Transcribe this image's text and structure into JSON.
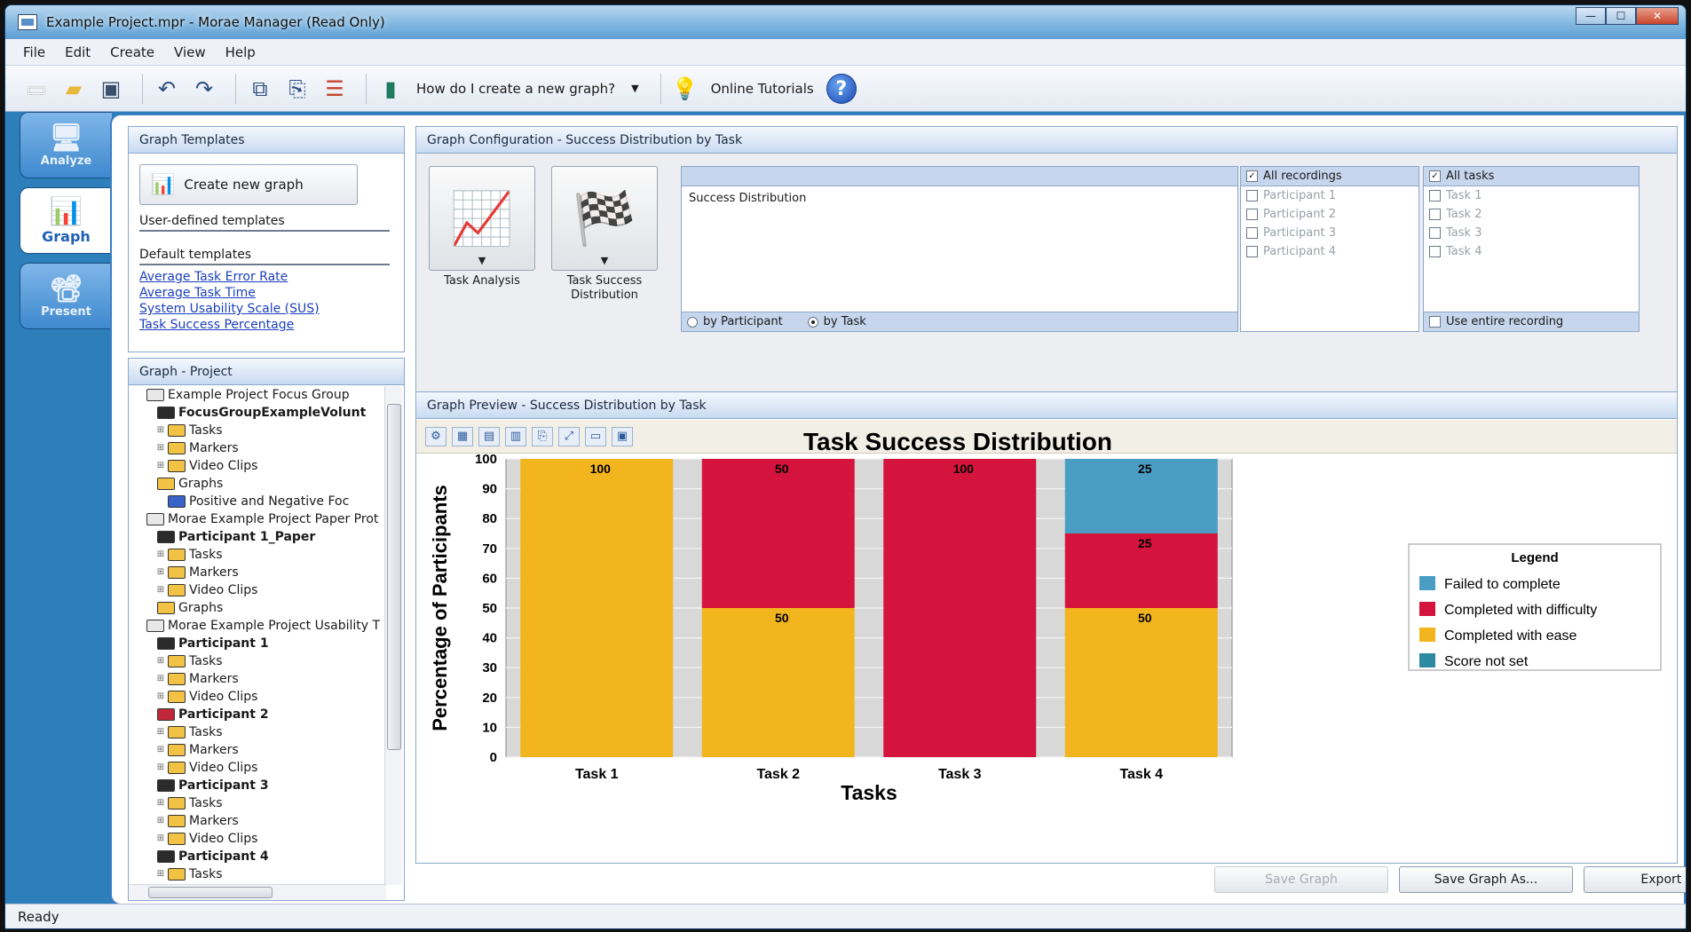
{
  "window": {
    "title": "Example Project.mpr - Morae Manager (Read Only)"
  },
  "menu": [
    "File",
    "Edit",
    "Create",
    "View",
    "Help"
  ],
  "toolbar": {
    "help_question": "How do I create a new graph?",
    "tutorials": "Online Tutorials",
    "help_glyph": "?"
  },
  "left_tabs": [
    {
      "label": "Analyze",
      "icon": "monitor-icon"
    },
    {
      "label": "Graph",
      "icon": "bar-chart-icon"
    },
    {
      "label": "Present",
      "icon": "projector-icon"
    }
  ],
  "templates": {
    "header": "Graph Templates",
    "create_button": "Create new graph",
    "user_defined": "User-defined templates",
    "default": "Default templates",
    "links": [
      "Average Task Error Rate",
      "Average Task Time",
      "System Usability Scale (SUS)",
      "Task Success Percentage"
    ]
  },
  "project": {
    "header": "Graph - Project",
    "tree": [
      {
        "level": 0,
        "text": "Example Project Focus Group",
        "icon": "project",
        "bold": false
      },
      {
        "level": 1,
        "text": "FocusGroupExampleVolunt",
        "icon": "recording",
        "bold": true
      },
      {
        "level": 2,
        "text": "Tasks",
        "icon": "folder-tasks",
        "bold": false
      },
      {
        "level": 2,
        "text": "Markers",
        "icon": "folder-markers",
        "bold": false
      },
      {
        "level": 2,
        "text": "Video Clips",
        "icon": "folder-clips",
        "bold": false
      },
      {
        "level": 1,
        "text": "Graphs",
        "icon": "folder-graphs",
        "bold": false
      },
      {
        "level": 2,
        "text": "Positive and Negative Foc",
        "icon": "graph",
        "bold": false
      },
      {
        "level": 0,
        "text": "Morae Example Project Paper Prot",
        "icon": "project",
        "bold": false
      },
      {
        "level": 1,
        "text": "Participant 1_Paper",
        "icon": "recording",
        "bold": true
      },
      {
        "level": 2,
        "text": "Tasks",
        "icon": "folder-tasks",
        "bold": false
      },
      {
        "level": 2,
        "text": "Markers",
        "icon": "folder-markers",
        "bold": false
      },
      {
        "level": 2,
        "text": "Video Clips",
        "icon": "folder-clips",
        "bold": false
      },
      {
        "level": 1,
        "text": "Graphs",
        "icon": "folder-graphs",
        "bold": false
      },
      {
        "level": 0,
        "text": "Morae Example Project Usability T",
        "icon": "project",
        "bold": false
      },
      {
        "level": 1,
        "text": "Participant 1",
        "icon": "recording",
        "bold": true
      },
      {
        "level": 2,
        "text": "Tasks",
        "icon": "folder-tasks",
        "bold": false
      },
      {
        "level": 2,
        "text": "Markers",
        "icon": "folder-markers",
        "bold": false
      },
      {
        "level": 2,
        "text": "Video Clips",
        "icon": "folder-clips",
        "bold": false
      },
      {
        "level": 1,
        "text": "Participant 2",
        "icon": "recording-red",
        "bold": true
      },
      {
        "level": 2,
        "text": "Tasks",
        "icon": "folder-tasks",
        "bold": false
      },
      {
        "level": 2,
        "text": "Markers",
        "icon": "folder-markers",
        "bold": false
      },
      {
        "level": 2,
        "text": "Video Clips",
        "icon": "folder-clips",
        "bold": false
      },
      {
        "level": 1,
        "text": "Participant 3",
        "icon": "recording",
        "bold": true
      },
      {
        "level": 2,
        "text": "Tasks",
        "icon": "folder-tasks",
        "bold": false
      },
      {
        "level": 2,
        "text": "Markers",
        "icon": "folder-markers",
        "bold": false
      },
      {
        "level": 2,
        "text": "Video Clips",
        "icon": "folder-clips",
        "bold": false
      },
      {
        "level": 1,
        "text": "Participant 4",
        "icon": "recording",
        "bold": true
      },
      {
        "level": 2,
        "text": "Tasks",
        "icon": "folder-tasks",
        "bold": false
      }
    ]
  },
  "config": {
    "header": "Graph Configuration - Success Distribution by Task",
    "graph_types": [
      "Task Analysis",
      "Task Success Distribution"
    ],
    "list_items": [
      "Success Distribution"
    ],
    "by_participant": "by Participant",
    "by_task": "by Task",
    "recordings_header": "All recordings",
    "recordings": [
      "Participant 1",
      "Participant 2",
      "Participant 3",
      "Participant 4"
    ],
    "tasks_header": "All tasks",
    "tasks": [
      "Task 1",
      "Task 2",
      "Task 3",
      "Task 4"
    ],
    "use_entire": "Use entire recording"
  },
  "preview": {
    "header": "Graph Preview - Success Distribution by Task"
  },
  "buttons": {
    "save": "Save Graph",
    "save_as": "Save Graph As...",
    "export": "Export As",
    "export_arrow": "▼"
  },
  "status": "Ready",
  "colors": {
    "failed": "#4a9ec4",
    "difficulty": "#d4143c",
    "ease": "#f2b51d",
    "not_set": "#2e8aa0",
    "plot_bg": "#d8d8d8"
  },
  "chart_data": {
    "type": "bar",
    "stacked": true,
    "title": "Task Success Distribution",
    "xlabel": "Tasks",
    "ylabel": "Percentage of Participants",
    "ylim": [
      0,
      100
    ],
    "yticks": [
      0,
      10,
      20,
      30,
      40,
      50,
      60,
      70,
      80,
      90,
      100
    ],
    "categories": [
      "Task 1",
      "Task 2",
      "Task 3",
      "Task 4"
    ],
    "series": [
      {
        "name": "Completed with ease",
        "values": [
          100,
          50,
          0,
          50
        ]
      },
      {
        "name": "Completed with difficulty",
        "values": [
          0,
          50,
          100,
          25
        ]
      },
      {
        "name": "Failed to complete",
        "values": [
          0,
          0,
          0,
          25
        ]
      },
      {
        "name": "Score not set",
        "values": [
          0,
          0,
          0,
          0
        ]
      }
    ],
    "legend_title": "Legend",
    "legend_order": [
      "Failed to complete",
      "Completed with difficulty",
      "Completed with ease",
      "Score not set"
    ],
    "legend_position": "right",
    "grid": true
  }
}
